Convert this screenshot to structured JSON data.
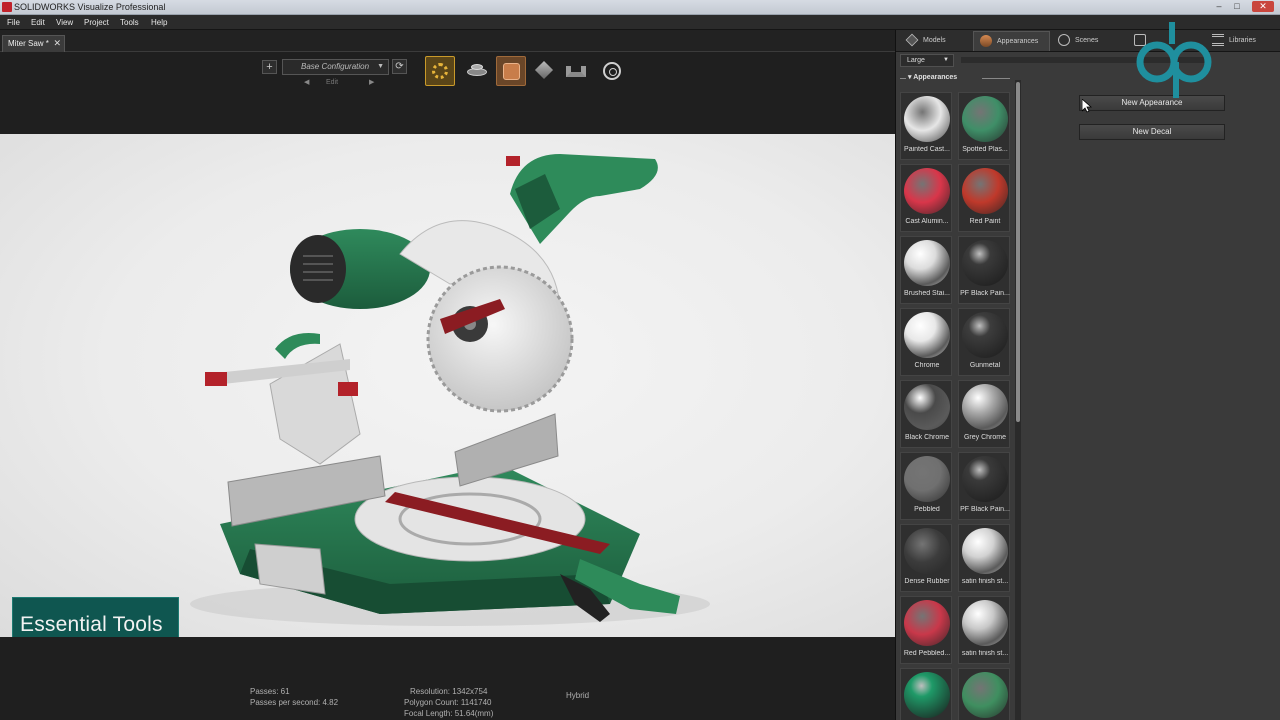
{
  "window": {
    "title": "SOLIDWORKS Visualize Professional"
  },
  "menu": [
    "File",
    "Edit",
    "View",
    "Project",
    "Tools",
    "Help"
  ],
  "document_tab": {
    "label": "Miter Saw *",
    "close": "✕"
  },
  "toolbar": {
    "add_label": "+",
    "configuration": "Base Configuration",
    "edit_label": "Edit",
    "refresh_glyph": "⟳"
  },
  "overlay": {
    "text": "Essential Tools"
  },
  "status": {
    "passes": "Passes: 61",
    "passes_per_second": "Passes per second: 4.82",
    "resolution": "Resolution: 1342x754",
    "polygon_count": "Polygon Count: 1141740",
    "focal_length": "Focal Length: 51.64(mm)",
    "mode": "Hybrid"
  },
  "panel": {
    "tabs": [
      {
        "label": "Models",
        "icon": "cube-icon"
      },
      {
        "label": "Appearances",
        "icon": "appearance-icon"
      },
      {
        "label": "Scenes",
        "icon": "scene-icon"
      },
      {
        "label": "",
        "icon": "camera-icon"
      },
      {
        "label": "Libraries",
        "icon": "libraries-icon"
      }
    ],
    "size": "Large",
    "section_title": "Appearances",
    "new_appearance": "New Appearance",
    "new_decal": "New Decal",
    "materials": [
      {
        "label": "Painted Cast...",
        "color": "#e6e6e6",
        "shade": "matte"
      },
      {
        "label": "Spotted Plas...",
        "color": "#3f8f68",
        "shade": "matte"
      },
      {
        "label": "Cast Alumin...",
        "color": "#d9364a",
        "shade": "matte"
      },
      {
        "label": "Red Paint",
        "color": "#c0392b",
        "shade": "matte"
      },
      {
        "label": "Brushed Stai...",
        "color": "#dcdcdc",
        "shade": "metal"
      },
      {
        "label": "PF Black Pain...",
        "color": "#3a3a3a",
        "shade": "gloss"
      },
      {
        "label": "Chrome",
        "color": "#e8e8e8",
        "shade": "metal"
      },
      {
        "label": "Gunmetal",
        "color": "#3d3d3d",
        "shade": "gloss"
      },
      {
        "label": "Black Chrome",
        "color": "#4a4a4a",
        "shade": "metal"
      },
      {
        "label": "Grey Chrome",
        "color": "#a8a8a8",
        "shade": "metal"
      },
      {
        "label": "Pebbled",
        "color": "#707070",
        "shade": "matte"
      },
      {
        "label": "PF Black Pain...",
        "color": "#3a3a3a",
        "shade": "gloss"
      },
      {
        "label": "Dense Rubber",
        "color": "#3c3c3c",
        "shade": "matte"
      },
      {
        "label": "satin finish st...",
        "color": "#d2d2d2",
        "shade": "metal"
      },
      {
        "label": "Red Pebbled...",
        "color": "#c9384a",
        "shade": "matte"
      },
      {
        "label": "satin finish st...",
        "color": "#c8c8c8",
        "shade": "metal"
      },
      {
        "label": "",
        "color": "#1f9a68",
        "shade": "gloss"
      },
      {
        "label": "",
        "color": "#3f8f60",
        "shade": "matte"
      }
    ]
  }
}
